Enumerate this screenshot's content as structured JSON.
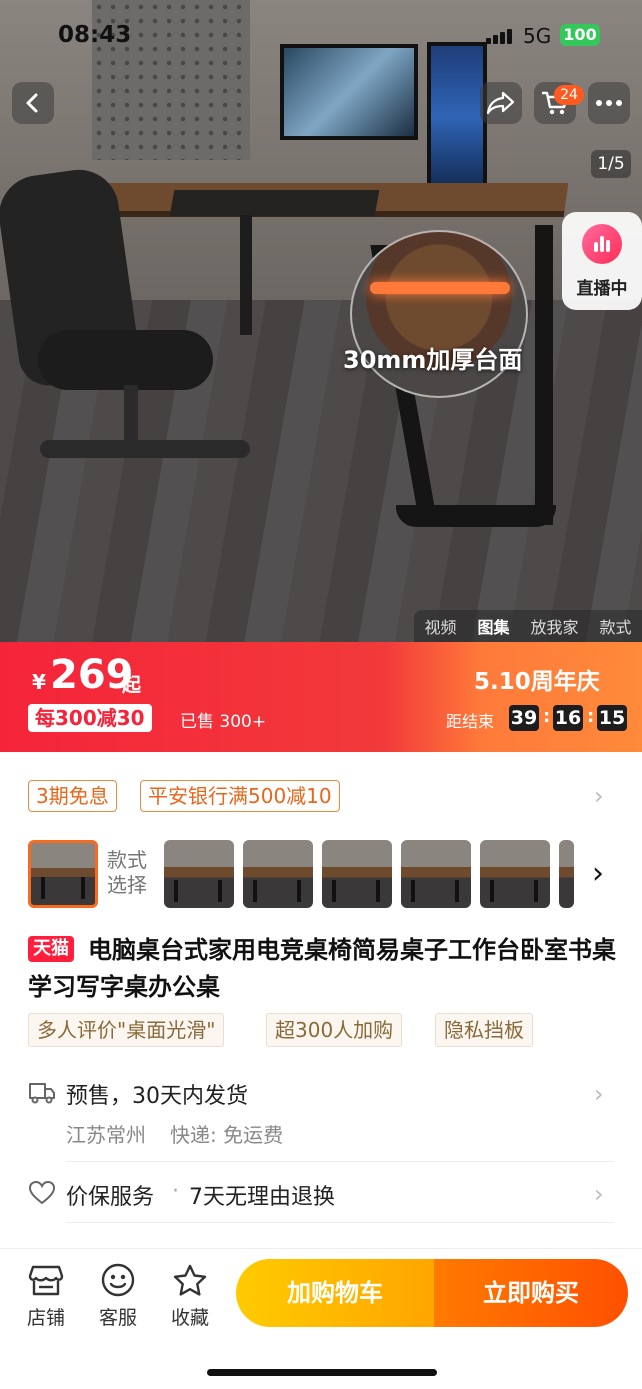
{
  "status_bar": {
    "time": "08:43",
    "network": "5G",
    "battery": "100"
  },
  "hero": {
    "caption": "30mm加厚台面",
    "cart_count": "24",
    "pager": "1/5",
    "live_label": "直播中",
    "media_tabs": [
      "视频",
      "图集",
      "放我家",
      "款式"
    ],
    "active_media_tab": 1
  },
  "price_band": {
    "currency": "¥",
    "price": "269",
    "price_suffix": "起",
    "coupon": "每300减30",
    "sold": "已售 300+",
    "promo_title": "5.10周年庆",
    "countdown_label": "距结束",
    "countdown": [
      "39",
      "16",
      "15"
    ]
  },
  "offers": {
    "installment": "3期免息",
    "bank": "平安银行满500减10"
  },
  "style_select": {
    "label_line1": "款式",
    "label_line2": "选择"
  },
  "product": {
    "store_tag": "天猫",
    "title": "电脑桌台式家用电竞桌椅简易桌子工作台卧室书桌学习写字桌办公桌",
    "features": [
      "多人评价\"桌面光滑\"",
      "超300人加购",
      "隐私挡板"
    ]
  },
  "shipping": {
    "headline": "预售，30天内发货",
    "origin": "江苏常州",
    "courier": "快递: 免运费"
  },
  "service": {
    "headline": "价保服务",
    "detail": "7天无理由退换"
  },
  "bottom_bar": {
    "store": "店铺",
    "service": "客服",
    "favorite": "收藏",
    "add_to_cart": "加购物车",
    "buy_now": "立即购买"
  }
}
